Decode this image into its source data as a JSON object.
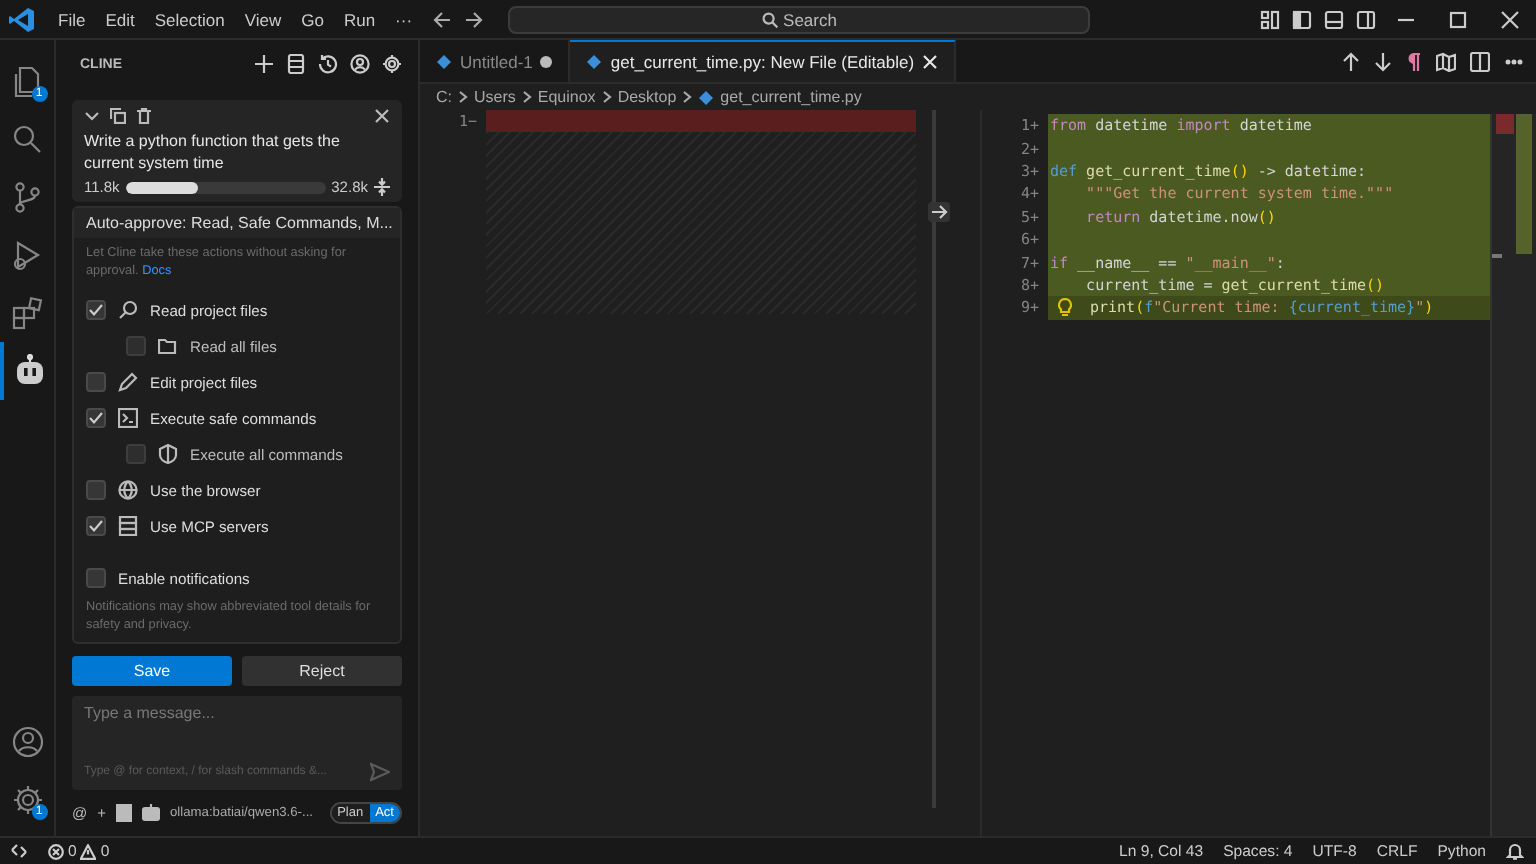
{
  "menu": [
    "File",
    "Edit",
    "Selection",
    "View",
    "Go",
    "Run",
    "···"
  ],
  "search": {
    "placeholder": "Search"
  },
  "activity_bar": {
    "items": [
      {
        "selected": false,
        "badge": "1"
      },
      {
        "selected": false
      },
      {
        "selected": false
      },
      {
        "selected": false
      },
      {
        "selected": false
      },
      {
        "selected": true
      }
    ],
    "bottom": [
      {
        "selected": false
      },
      {
        "selected": false,
        "badge": "1"
      }
    ]
  },
  "cline": {
    "title": "CLINE",
    "task": {
      "text": "Write a python function that gets the current system time",
      "context_used": "11.8k",
      "level": 0.36,
      "context_max": "32.8k"
    },
    "auto_approve": {
      "summary": "Auto-approve: Read, Safe Commands, M...",
      "description": "Let Cline take these actions without asking for approval.",
      "link": "Docs",
      "options": [
        {
          "label": "Read project files",
          "checked": true,
          "disabled": false,
          "children": [
            {
              "label": "Read all files",
              "checked": false,
              "disabled": true
            }
          ]
        },
        {
          "label": "Edit project files",
          "checked": false,
          "disabled": false
        },
        {
          "label": "Execute safe commands",
          "checked": true,
          "disabled": false,
          "children": [
            {
              "label": "Execute all commands",
              "checked": false,
              "disabled": true
            }
          ]
        },
        {
          "label": "Use the browser",
          "checked": false,
          "disabled": false
        },
        {
          "label": "Use MCP servers",
          "checked": true,
          "disabled": false
        }
      ],
      "notifications": {
        "label": "Enable notifications",
        "checked": false,
        "note": "Notifications may show abbreviated tool details for safety and privacy."
      }
    },
    "buttons": [
      {
        "label": "Save",
        "kind": "primary"
      },
      {
        "label": "Reject",
        "kind": "secondary"
      }
    ],
    "message": {
      "placeholder": "Type a message...",
      "hint": "Type @ for context, / for slash commands &..."
    },
    "toolbar": [
      "@",
      "+"
    ],
    "model": "ollama:batiai/qwen3.6-...",
    "modes": [
      {
        "label": "Plan",
        "selected": false
      },
      {
        "label": "Act",
        "selected": true
      }
    ]
  },
  "editor": {
    "tabs": [
      {
        "label": "Untitled-1",
        "selected": false,
        "dirty": true
      },
      {
        "label": "get_current_time.py: New File (Editable)",
        "selected": true,
        "dirty": false
      }
    ],
    "breadcrumb": [
      "C:",
      "Users",
      "Equinox",
      "Desktop",
      "get_current_time.py"
    ],
    "original": {
      "lines": [
        {
          "number": "1",
          "marker": "−"
        }
      ]
    },
    "modified": {
      "lines": [
        {
          "number": "1",
          "marker": "+",
          "current": false,
          "tokens": [
            {
              "t": "from",
              "kind": "keyword"
            },
            {
              "t": " datetime ",
              "kind": "plain"
            },
            {
              "t": "import",
              "kind": "keyword"
            },
            {
              "t": " datetime",
              "kind": "plain"
            }
          ]
        },
        {
          "number": "2",
          "marker": "+",
          "current": false
        },
        {
          "number": "3",
          "marker": "+",
          "current": false,
          "tokens": [
            {
              "t": "def",
              "kind": "storage"
            },
            {
              "t": " get_current_time",
              "kind": "function"
            },
            {
              "t": "()",
              "kind": "bracket"
            },
            {
              "t": " -> datetime:",
              "kind": "plain"
            }
          ]
        },
        {
          "number": "4",
          "marker": "+",
          "current": false,
          "tokens": [
            {
              "t": "    \"\"\"Get the current system time.\"\"\"",
              "kind": "string"
            }
          ]
        },
        {
          "number": "5",
          "marker": "+",
          "current": false,
          "tokens": [
            {
              "t": "    return",
              "kind": "keyword"
            },
            {
              "t": " datetime.now",
              "kind": "plain"
            },
            {
              "t": "()",
              "kind": "bracket"
            }
          ]
        },
        {
          "number": "6",
          "marker": "+",
          "current": false
        },
        {
          "number": "7",
          "marker": "+",
          "current": false,
          "tokens": [
            {
              "t": "if",
              "kind": "keyword"
            },
            {
              "t": " __name__ == ",
              "kind": "plain"
            },
            {
              "t": "\"__main__\"",
              "kind": "string"
            },
            {
              "t": ":",
              "kind": "plain"
            }
          ]
        },
        {
          "number": "8",
          "marker": "+",
          "current": false,
          "tokens": [
            {
              "t": "    current_time = ",
              "kind": "plain"
            },
            {
              "t": "get_current_time",
              "kind": "function"
            },
            {
              "t": "()",
              "kind": "bracket"
            }
          ]
        },
        {
          "number": "9",
          "marker": "+",
          "current": true,
          "tokens": [
            {
              "t": "print",
              "kind": "function"
            },
            {
              "t": "(",
              "kind": "bracket"
            },
            {
              "t": "f",
              "kind": "storage"
            },
            {
              "t": "\"Current time: ",
              "kind": "string"
            },
            {
              "t": "{current_time}",
              "kind": "storage"
            },
            {
              "t": "\"",
              "kind": "string"
            },
            {
              "t": ")",
              "kind": "bracket"
            }
          ]
        }
      ]
    }
  },
  "status_bar": {
    "problems": [
      {
        "kind": "error",
        "count": "0"
      },
      {
        "kind": "warning",
        "count": "0"
      }
    ],
    "items": [
      "Ln 9, Col 43",
      "Spaces: 4",
      "UTF-8",
      "CRLF",
      "Python"
    ]
  }
}
